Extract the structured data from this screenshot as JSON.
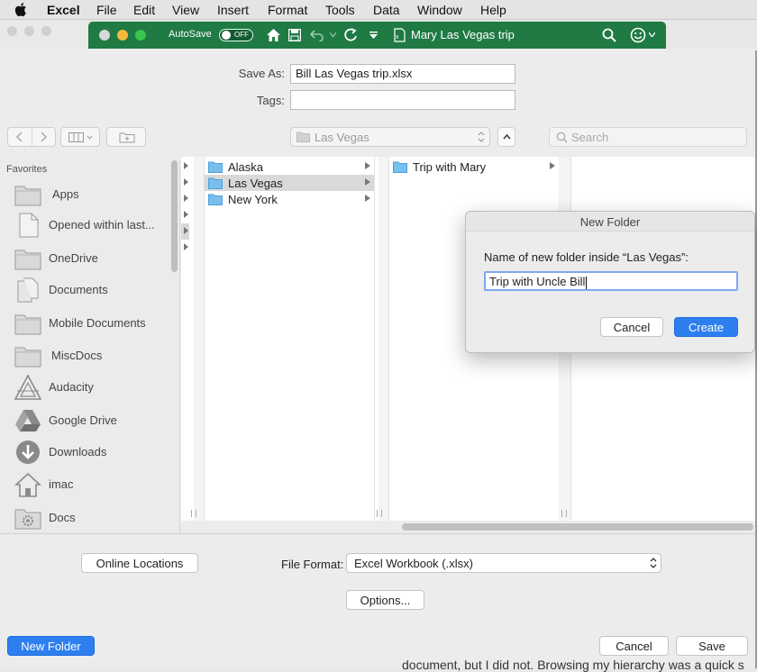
{
  "menubar": {
    "app": "Excel",
    "items": [
      "File",
      "Edit",
      "View",
      "Insert",
      "Format",
      "Tools",
      "Data",
      "Window",
      "Help"
    ]
  },
  "excel_bar": {
    "autosave_label": "AutoSave",
    "autosave_state": "OFF",
    "doc_title": "Mary Las Vegas trip",
    "color": "#1f7a44"
  },
  "save_sheet": {
    "save_as_label": "Save As:",
    "save_as_value": "Bill Las Vegas trip.xlsx",
    "tags_label": "Tags:",
    "tags_value": "",
    "location": "Las Vegas",
    "search_placeholder": "Search"
  },
  "sidebar": {
    "header": "Favorites",
    "items": [
      {
        "label": "Apps",
        "icon": "folder-icon"
      },
      {
        "label": "Opened within last...",
        "icon": "document-icon"
      },
      {
        "label": "OneDrive",
        "icon": "folder-icon"
      },
      {
        "label": "Documents",
        "icon": "documents-icon"
      },
      {
        "label": "Mobile Documents",
        "icon": "folder-icon"
      },
      {
        "label": "MiscDocs",
        "icon": "folder-icon"
      },
      {
        "label": "Audacity",
        "icon": "audacity-icon"
      },
      {
        "label": "Google Drive",
        "icon": "google-drive-icon"
      },
      {
        "label": "Downloads",
        "icon": "downloads-icon"
      },
      {
        "label": "imac",
        "icon": "home-icon"
      },
      {
        "label": "Docs",
        "icon": "gear-folder-icon"
      }
    ]
  },
  "browser": {
    "column1": [
      "Alaska",
      "Las Vegas",
      "New York"
    ],
    "column1_selected": "Las Vegas",
    "column2": [
      "Trip with Mary"
    ]
  },
  "dialog": {
    "title": "New Folder",
    "prompt": "Name of new folder inside “Las Vegas”:",
    "input_value": "Trip with Uncle Bill",
    "cancel_label": "Cancel",
    "create_label": "Create"
  },
  "bottom": {
    "online_locations_label": "Online Locations",
    "file_format_label": "File Format:",
    "file_format_value": "Excel Workbook (.xlsx)",
    "options_label": "Options...",
    "new_folder_label": "New Folder",
    "cancel_label": "Cancel",
    "save_label": "Save",
    "background_text": "document, but I did not. Browsing my hierarchy was a quick s"
  }
}
